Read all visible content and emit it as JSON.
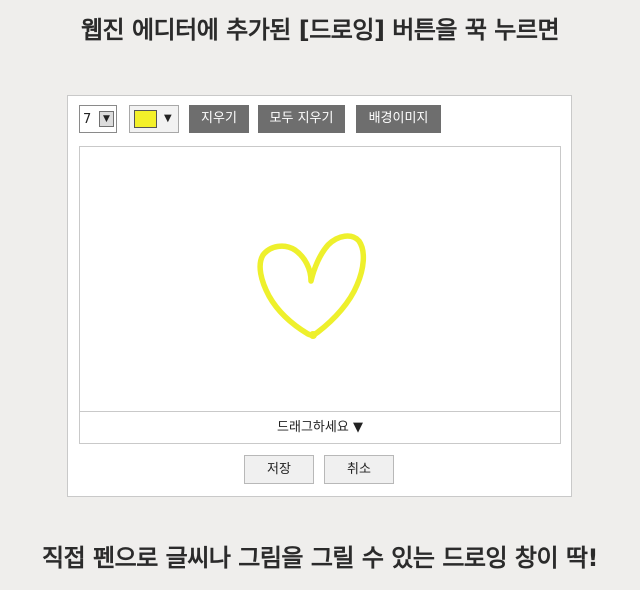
{
  "headings": {
    "top": "웹진 에디터에 추가된 [드로잉] 버튼을 꾹 누르면",
    "bottom": "직접 펜으로 글씨나 그림을 그릴 수 있는 드로잉 창이 딱!"
  },
  "toolbar": {
    "pen_size": "7",
    "pen_color": "#f3f02a",
    "erase_label": "지우기",
    "erase_all_label": "모두 지우기",
    "background_image_label": "배경이미지"
  },
  "canvas": {
    "drawing": "heart",
    "stroke_color": "#eef02c",
    "drag_hint": "드래그하세요 ▼"
  },
  "actions": {
    "save_label": "저장",
    "cancel_label": "취소"
  },
  "colors": {
    "page_background": "#efeeec",
    "toolbar_button": "#6e6e6e"
  }
}
